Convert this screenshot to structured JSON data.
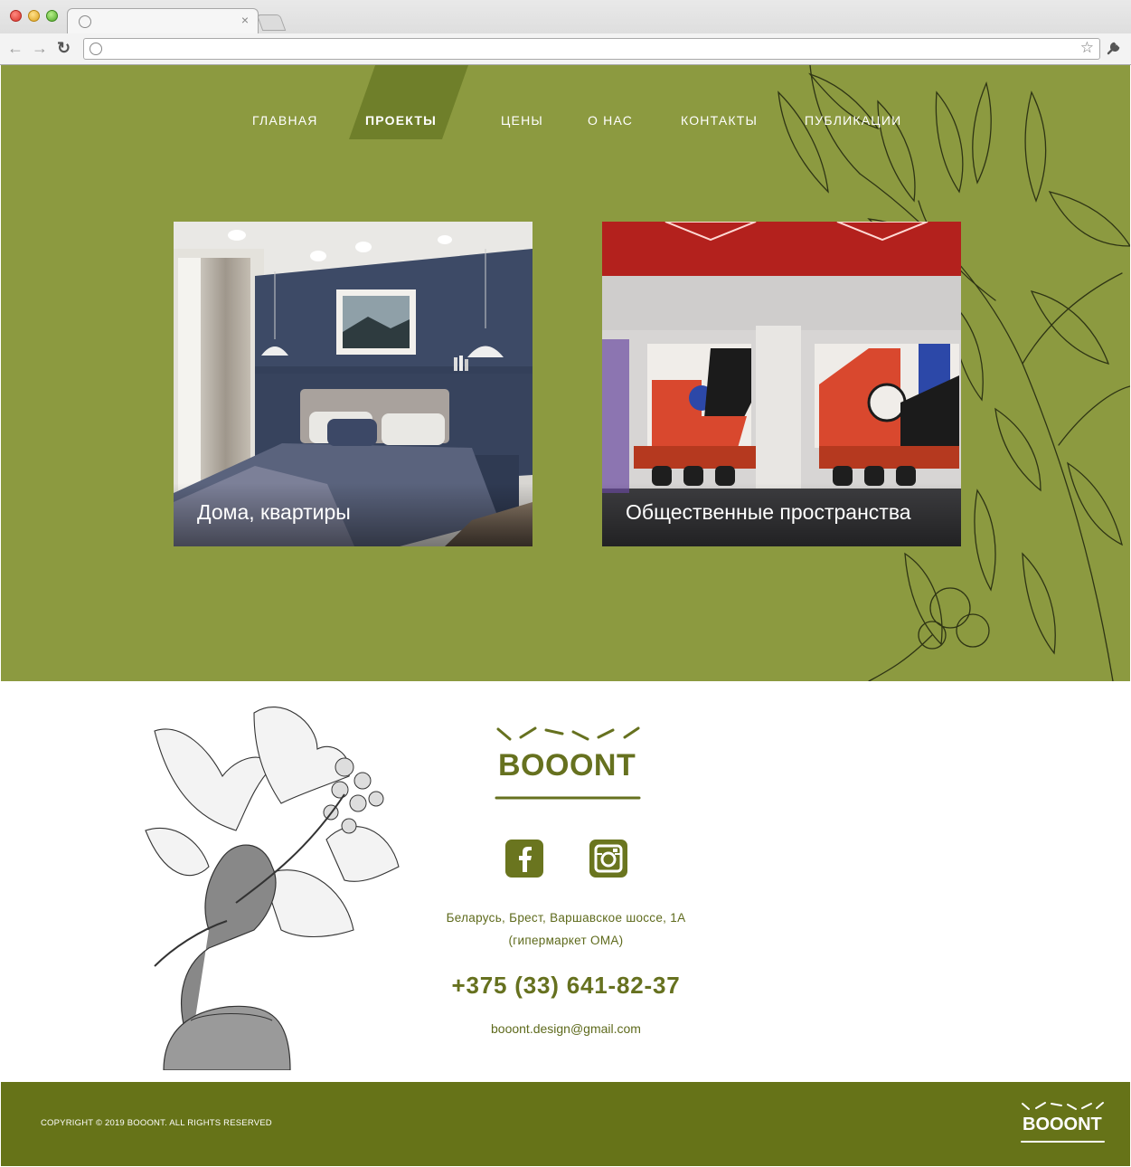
{
  "browser": {
    "tab_title": "",
    "tab_close_glyph": "×",
    "back_glyph": "←",
    "forward_glyph": "→",
    "reload_glyph": "↻",
    "url": "",
    "bookmark_glyph": "☆",
    "menu_glyph": "🔧"
  },
  "nav": {
    "items": [
      {
        "label": "ГЛАВНАЯ"
      },
      {
        "label": "ПРОЕКТЫ",
        "active": true
      },
      {
        "label": "ЦЕНЫ"
      },
      {
        "label": "О НАС"
      },
      {
        "label": "КОНТАКТЫ"
      },
      {
        "label": "ПУБЛИКАЦИИ"
      }
    ]
  },
  "projects": [
    {
      "label": "Дома, квартиры"
    },
    {
      "label": "Общественные пространства"
    }
  ],
  "contact": {
    "logo_text": "BOOONT",
    "social": [
      {
        "icon": "facebook-icon"
      },
      {
        "icon": "instagram-icon"
      }
    ],
    "address_line1": "Беларусь, Брест, Варшавское шоссе, 1А",
    "address_line2": "(гипермаркет ОМА)",
    "phone": "+375 (33) 641-82-37",
    "email": "booont.design@gmail.com"
  },
  "footer": {
    "copyright": "COPYRIGHT © 2019 BOOONT. ALL RIGHTS RESERVED",
    "logo_text": "BOOONT"
  },
  "colors": {
    "hero_green": "#8c9a40",
    "accent_olive": "#66711f",
    "nav_active": "#6f7f2a",
    "footer_green": "#667318"
  }
}
